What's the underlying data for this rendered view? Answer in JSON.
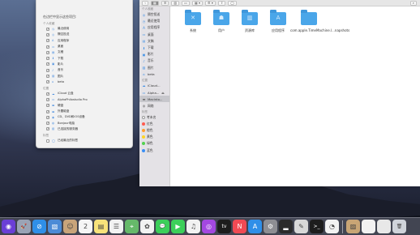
{
  "preferences": {
    "title": "在边栏中显示这些项目:",
    "sections": [
      {
        "heading": "个人收藏",
        "items": [
          {
            "label": "最近使用",
            "icon": "clock-icon",
            "checked": true
          },
          {
            "label": "隔空投送",
            "icon": "airdrop-icon",
            "checked": true
          },
          {
            "label": "应用程序",
            "icon": "apps-icon",
            "checked": true
          },
          {
            "label": "桌面",
            "icon": "desktop-icon",
            "checked": true
          },
          {
            "label": "文稿",
            "icon": "document-icon",
            "checked": true
          },
          {
            "label": "下载",
            "icon": "download-icon",
            "checked": true
          },
          {
            "label": "影片",
            "icon": "movie-icon",
            "checked": true
          },
          {
            "label": "音乐",
            "icon": "music-icon",
            "checked": true
          },
          {
            "label": "图片",
            "icon": "picture-icon",
            "checked": true
          },
          {
            "label": "beta",
            "icon": "home-icon",
            "checked": true
          }
        ]
      },
      {
        "heading": "位置",
        "items": [
          {
            "label": "iCloud 云盘",
            "icon": "cloud-icon",
            "checked": true
          },
          {
            "label": "AlphaPhilostudio Pro",
            "icon": "laptop-icon",
            "checked": true
          },
          {
            "label": "硬盘",
            "icon": "disk-icon",
            "checked": true
          },
          {
            "label": "外置磁盘",
            "icon": "external-disk-icon",
            "checked": true
          },
          {
            "label": "CD、DVD和iOS设备",
            "icon": "cd-icon",
            "checked": true
          },
          {
            "label": "Bonjour电脑",
            "icon": "bonjour-icon",
            "checked": true
          },
          {
            "label": "已连接的服务器",
            "icon": "server-icon",
            "checked": true
          }
        ]
      },
      {
        "heading": "标签",
        "items": [
          {
            "label": "已经最近的标签",
            "icon": "tag-icon",
            "checked": false
          }
        ]
      }
    ]
  },
  "finder": {
    "toolbar": {
      "view_buttons": [
        "▦",
        "☰",
        "▥",
        "▭"
      ],
      "group_button": "▦ ▾",
      "action_button": "⚙ ▾",
      "share_button": "⇪",
      "tag_button": "◯",
      "search_icon": "search-icon"
    },
    "sidebar": {
      "sections": [
        {
          "heading": "个人收藏",
          "items": [
            {
              "label": "隔空投送",
              "icon": "airdrop-icon",
              "glyph": "◎"
            },
            {
              "label": "最近使用",
              "icon": "clock-icon",
              "glyph": "◷"
            },
            {
              "label": "应用程序",
              "icon": "apps-icon",
              "glyph": "A"
            },
            {
              "label": "桌面",
              "icon": "desktop-icon",
              "glyph": "▭"
            },
            {
              "label": "文稿",
              "icon": "document-icon",
              "glyph": "▤"
            },
            {
              "label": "下载",
              "icon": "download-icon",
              "glyph": "⬇"
            },
            {
              "label": "影片",
              "icon": "movie-icon",
              "glyph": "▣"
            },
            {
              "label": "音乐",
              "icon": "music-icon",
              "glyph": "♪"
            },
            {
              "label": "图片",
              "icon": "picture-icon",
              "glyph": "▨"
            },
            {
              "label": "beta",
              "icon": "home-icon",
              "glyph": "⌂"
            }
          ]
        },
        {
          "heading": "位置",
          "items": [
            {
              "label": "iCloud...",
              "icon": "cloud-icon",
              "glyph": "☁"
            },
            {
              "label": "Alpha...",
              "icon": "laptop-icon",
              "glyph": "▭",
              "trailing": "⏏"
            },
            {
              "label": "Macinto...",
              "icon": "disk-icon",
              "glyph": "▬",
              "selected": true
            },
            {
              "label": "网络",
              "icon": "network-icon",
              "glyph": "◍"
            }
          ]
        },
        {
          "heading": "标签",
          "items": [
            {
              "label": "考未名",
              "tag_color": "#ffffff"
            },
            {
              "label": "红色",
              "tag_color": "#ff5b50"
            },
            {
              "label": "橙色",
              "tag_color": "#ff9f2e"
            },
            {
              "label": "黄色",
              "tag_color": "#ffd426"
            },
            {
              "label": "绿色",
              "tag_color": "#52d14f"
            },
            {
              "label": "蓝色",
              "tag_color": "#3b8ff5"
            }
          ]
        }
      ]
    },
    "files": [
      {
        "label": "系统",
        "icon": "system-folder-icon",
        "glyph": "✕"
      },
      {
        "label": "用户",
        "icon": "users-folder-icon",
        "glyph": "☗"
      },
      {
        "label": "资源库",
        "icon": "library-folder-icon",
        "glyph": "▥"
      },
      {
        "label": "应用程序",
        "icon": "apps-folder-icon",
        "glyph": "A"
      },
      {
        "label": "com.apple.TimeMachine.l...napshots",
        "icon": "folder-icon",
        "glyph": ""
      }
    ]
  },
  "dock": {
    "apps": [
      {
        "name": "siri-icon",
        "color": "#6a3fd6",
        "glyph": "◉"
      },
      {
        "name": "launchpad-icon",
        "color": "#9aa3b5",
        "glyph": "🚀"
      },
      {
        "name": "safari-icon",
        "color": "#2f8fe8",
        "glyph": "⊘"
      },
      {
        "name": "photo-browser-icon",
        "color": "#4c8bd6",
        "glyph": "▧"
      },
      {
        "name": "contacts-icon",
        "color": "#c9a47a",
        "glyph": "☺"
      },
      {
        "name": "calendar-icon",
        "color": "#f5f5f5",
        "glyph": "2"
      },
      {
        "name": "notes-icon",
        "color": "#f7e27a",
        "glyph": "▤"
      },
      {
        "name": "reminders-icon",
        "color": "#f2f2f2",
        "glyph": "☰"
      },
      {
        "name": "maps-icon",
        "color": "#66b96a",
        "glyph": "⌖"
      },
      {
        "name": "photos-icon",
        "color": "#f2f2f2",
        "glyph": "✿"
      },
      {
        "name": "messages-icon",
        "color": "#3ccf5a",
        "glyph": "💬"
      },
      {
        "name": "facetime-icon",
        "color": "#3ccf5a",
        "glyph": "▶"
      },
      {
        "name": "itunes-icon",
        "color": "#f2f2f2",
        "glyph": "♫"
      },
      {
        "name": "podcasts-icon",
        "color": "#a348e0",
        "glyph": "◎"
      },
      {
        "name": "tv-icon",
        "color": "#1d1d1d",
        "glyph": "tv"
      },
      {
        "name": "news-icon",
        "color": "#f04a54",
        "glyph": "N"
      },
      {
        "name": "app-store-icon",
        "color": "#2f8fe8",
        "glyph": "A"
      },
      {
        "name": "system-preferences-icon",
        "color": "#8e8e93",
        "glyph": "⚙"
      },
      {
        "name": "activity-monitor-icon",
        "color": "#2b2b2b",
        "glyph": "▂"
      },
      {
        "name": "script-editor-icon",
        "color": "#d8d8d8",
        "glyph": "✎"
      },
      {
        "name": "terminal-icon",
        "color": "#1d1d1d",
        "glyph": ">_"
      },
      {
        "name": "chrome-icon",
        "color": "#f2f2f2",
        "glyph": "◔"
      },
      {
        "name": "preview-icon",
        "color": "#c8a575",
        "glyph": "▨"
      },
      {
        "name": "window-1-icon",
        "color": "#f2f2f2",
        "glyph": ""
      },
      {
        "name": "window-2-icon",
        "color": "#e8e8e8",
        "glyph": ""
      },
      {
        "name": "trash-icon",
        "color": "#cfd3da",
        "glyph": "🗑"
      }
    ]
  }
}
